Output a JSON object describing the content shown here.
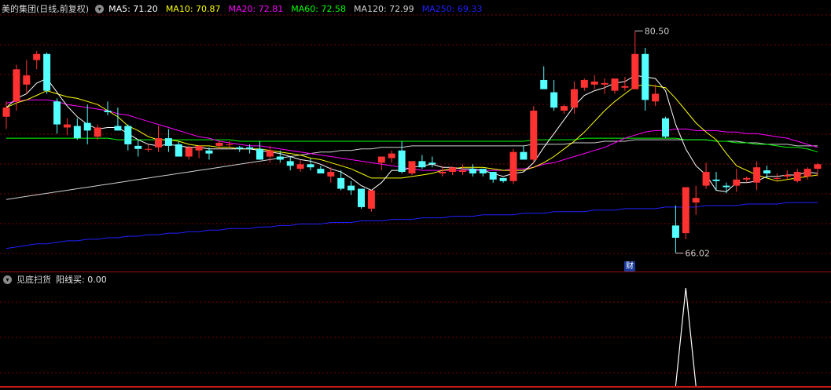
{
  "header": {
    "title": "美的集团(日线,前复权)",
    "collapse_icon": "chevron-down-icon",
    "ma": [
      {
        "label": "MA5: 71.20",
        "color": "#ffffff"
      },
      {
        "label": "MA10: 70.87",
        "color": "#ffff00"
      },
      {
        "label": "MA20: 72.81",
        "color": "#ff00ff"
      },
      {
        "label": "MA60: 72.58",
        "color": "#00ff00"
      },
      {
        "label": "MA120: 72.99",
        "color": "#d0d0d0"
      },
      {
        "label": "MA250: 69.33",
        "color": "#2020ff"
      }
    ]
  },
  "annotations": {
    "high_label": "80.50",
    "low_label": "66.02",
    "event_badge": "财"
  },
  "indicator": {
    "title": "见底扫货",
    "series_label": "阳线买: 0.00"
  },
  "colors": {
    "up": "#ff3232",
    "down": "#54ffff",
    "ma5": "#ffffff",
    "ma10": "#ffff00",
    "ma20": "#ff00ff",
    "ma60": "#00ff00",
    "ma120": "#d0d0d0",
    "ma250": "#2020ff",
    "grid": "#7a0000",
    "indicator_line": "#ffffff"
  },
  "chart_data": {
    "type": "candlestick",
    "y_range": [
      65.0,
      81.5
    ],
    "high_price": 80.5,
    "low_price": 66.02,
    "candles": [
      [
        74.9,
        75.9,
        74.1,
        75.5
      ],
      [
        75.9,
        78.3,
        75.3,
        78.0
      ],
      [
        77.0,
        78.6,
        76.4,
        77.6
      ],
      [
        78.6,
        79.2,
        78.0,
        79.0
      ],
      [
        79.0,
        79.1,
        76.4,
        76.6
      ],
      [
        75.9,
        76.1,
        73.8,
        74.4
      ],
      [
        74.2,
        74.8,
        73.7,
        74.4
      ],
      [
        74.3,
        74.8,
        73.4,
        73.5
      ],
      [
        74.5,
        75.7,
        73.1,
        74.0
      ],
      [
        73.6,
        74.4,
        73.4,
        74.2
      ],
      [
        75.3,
        75.9,
        75.0,
        75.2
      ],
      [
        74.3,
        75.5,
        74.0,
        74.0
      ],
      [
        74.3,
        74.4,
        72.7,
        73.1
      ],
      [
        73.0,
        73.4,
        72.3,
        72.8
      ],
      [
        72.8,
        73.1,
        72.6,
        72.8
      ],
      [
        72.9,
        74.3,
        72.6,
        73.5
      ],
      [
        73.5,
        74.1,
        72.6,
        73.0
      ],
      [
        73.1,
        73.3,
        72.3,
        72.3
      ],
      [
        72.3,
        73.0,
        72.1,
        72.9
      ],
      [
        72.7,
        73.0,
        72.2,
        73.0
      ],
      [
        72.7,
        72.9,
        72.1,
        72.5
      ],
      [
        73.0,
        73.3,
        72.8,
        73.2
      ],
      [
        73.1,
        73.3,
        72.9,
        73.1
      ],
      [
        72.9,
        73.0,
        72.6,
        72.8
      ],
      [
        72.9,
        73.1,
        72.5,
        72.8
      ],
      [
        72.8,
        73.3,
        72.1,
        72.1
      ],
      [
        72.3,
        73.0,
        71.9,
        72.7
      ],
      [
        72.3,
        72.7,
        71.9,
        72.1
      ],
      [
        72.0,
        72.3,
        71.4,
        71.7
      ],
      [
        71.5,
        72.1,
        71.3,
        71.8
      ],
      [
        71.8,
        72.2,
        71.4,
        71.6
      ],
      [
        71.5,
        71.7,
        71.2,
        71.2
      ],
      [
        71.0,
        71.6,
        70.6,
        71.3
      ],
      [
        70.9,
        71.4,
        70.1,
        70.2
      ],
      [
        70.4,
        70.7,
        69.8,
        70.1
      ],
      [
        70.2,
        70.2,
        68.9,
        69.0
      ],
      [
        68.9,
        70.1,
        68.7,
        70.1
      ],
      [
        71.9,
        72.3,
        71.4,
        72.3
      ],
      [
        72.2,
        72.7,
        71.9,
        72.5
      ],
      [
        72.7,
        73.3,
        71.2,
        71.3
      ],
      [
        71.2,
        72.0,
        71.1,
        72.0
      ],
      [
        72.0,
        72.4,
        71.5,
        71.6
      ],
      [
        71.9,
        72.3,
        71.6,
        71.8
      ],
      [
        71.2,
        71.7,
        71.0,
        71.3
      ],
      [
        71.3,
        71.6,
        71.1,
        71.6
      ],
      [
        71.3,
        71.8,
        71.1,
        71.4
      ],
      [
        71.5,
        71.8,
        71.0,
        71.2
      ],
      [
        71.5,
        71.4,
        71.0,
        71.2
      ],
      [
        71.3,
        71.3,
        70.6,
        70.8
      ],
      [
        70.9,
        70.9,
        70.6,
        70.7
      ],
      [
        70.7,
        72.8,
        70.5,
        72.6
      ],
      [
        72.6,
        73.0,
        72.1,
        72.1
      ],
      [
        72.1,
        75.6,
        71.9,
        75.3
      ],
      [
        77.3,
        78.2,
        76.8,
        76.7
      ],
      [
        76.5,
        77.3,
        75.3,
        75.5
      ],
      [
        75.3,
        75.7,
        75.1,
        75.6
      ],
      [
        75.5,
        77.2,
        75.1,
        76.7
      ],
      [
        76.8,
        77.4,
        76.6,
        77.3
      ],
      [
        77.0,
        77.6,
        76.7,
        77.2
      ],
      [
        77.0,
        77.4,
        76.4,
        77.1
      ],
      [
        76.6,
        77.2,
        76.4,
        77.4
      ],
      [
        76.8,
        77.5,
        76.6,
        76.9
      ],
      [
        76.7,
        80.5,
        76.7,
        79.0
      ],
      [
        79.0,
        79.4,
        75.3,
        76.0
      ],
      [
        75.9,
        77.0,
        75.6,
        76.4
      ],
      [
        74.8,
        74.9,
        73.5,
        73.6
      ],
      [
        67.8,
        69.1,
        66.0,
        67.0
      ],
      [
        67.3,
        70.2,
        66.9,
        70.3
      ],
      [
        69.3,
        70.4,
        68.5,
        69.6
      ],
      [
        70.4,
        71.9,
        70.2,
        71.3
      ],
      [
        70.8,
        71.3,
        70.1,
        70.7
      ],
      [
        70.4,
        70.6,
        69.9,
        70.3
      ],
      [
        70.4,
        71.5,
        70.0,
        70.8
      ],
      [
        70.8,
        71.0,
        70.6,
        70.9
      ],
      [
        70.6,
        72.0,
        70.1,
        71.6
      ],
      [
        71.4,
        71.7,
        70.9,
        71.2
      ],
      [
        70.9,
        71.2,
        70.7,
        70.9
      ],
      [
        71.0,
        71.4,
        70.8,
        71.1
      ],
      [
        70.7,
        71.5,
        70.6,
        71.3
      ],
      [
        71.0,
        71.6,
        70.8,
        71.5
      ],
      [
        71.5,
        71.9,
        71.0,
        71.8
      ]
    ],
    "ma5": [
      75.5,
      76.1,
      76.4,
      77.1,
      77.4,
      76.5,
      75.6,
      74.9,
      74.4,
      74.1,
      74.2,
      74.2,
      73.8,
      73.4,
      73.1,
      73.0,
      73.1,
      73.0,
      72.9,
      72.9,
      72.8,
      72.8,
      72.8,
      72.8,
      72.8,
      72.7,
      72.6,
      72.5,
      72.3,
      72.1,
      72.0,
      71.8,
      71.5,
      71.3,
      70.9,
      70.4,
      70.1,
      70.6,
      71.4,
      71.4,
      71.6,
      71.7,
      71.8,
      71.6,
      71.6,
      71.5,
      71.5,
      71.4,
      71.2,
      71.0,
      71.2,
      71.3,
      71.9,
      72.9,
      73.8,
      74.7,
      75.6,
      76.3,
      76.6,
      76.8,
      77.1,
      77.2,
      77.6,
      77.5,
      77.4,
      76.6,
      74.4,
      72.8,
      71.7,
      71.1,
      70.1,
      70.0,
      70.6,
      70.6,
      70.7,
      71.0,
      71.0,
      71.1,
      71.1,
      71.3,
      71.2
    ],
    "ma10": [
      75.5,
      75.8,
      76.0,
      76.3,
      76.6,
      76.4,
      76.2,
      76.1,
      75.9,
      75.7,
      75.3,
      74.9,
      74.3,
      74.0,
      73.6,
      73.4,
      73.4,
      73.3,
      73.1,
      73.0,
      73.0,
      72.9,
      72.9,
      72.8,
      72.8,
      72.8,
      72.7,
      72.6,
      72.5,
      72.4,
      72.2,
      72.1,
      71.9,
      71.7,
      71.5,
      71.2,
      70.9,
      70.9,
      70.9,
      70.9,
      71.0,
      71.1,
      71.2,
      71.4,
      71.5,
      71.6,
      71.6,
      71.6,
      71.5,
      71.4,
      71.4,
      71.4,
      71.6,
      71.9,
      72.3,
      72.8,
      73.3,
      73.9,
      74.6,
      75.3,
      75.9,
      76.4,
      76.9,
      77.0,
      76.9,
      76.8,
      76.1,
      75.3,
      74.5,
      73.9,
      73.4,
      72.5,
      71.7,
      71.4,
      71.1,
      70.9,
      70.7,
      70.8,
      70.9,
      71.0,
      71.1
    ],
    "ma20": [
      75.8,
      75.9,
      76.0,
      76.0,
      76.0,
      75.9,
      75.7,
      75.6,
      75.5,
      75.4,
      75.3,
      75.1,
      75.0,
      74.8,
      74.6,
      74.4,
      74.2,
      74.0,
      73.8,
      73.6,
      73.5,
      73.3,
      73.2,
      73.1,
      73.0,
      73.0,
      72.9,
      72.8,
      72.7,
      72.6,
      72.5,
      72.4,
      72.3,
      72.2,
      72.1,
      72.0,
      71.9,
      71.8,
      71.7,
      71.6,
      71.5,
      71.4,
      71.4,
      71.4,
      71.4,
      71.4,
      71.4,
      71.4,
      71.4,
      71.4,
      71.5,
      71.5,
      71.6,
      71.8,
      71.9,
      72.1,
      72.3,
      72.5,
      72.7,
      72.9,
      73.2,
      73.5,
      73.7,
      73.9,
      74.0,
      74.0,
      74.1,
      74.1,
      74.0,
      74.0,
      74.0,
      73.9,
      73.9,
      73.8,
      73.8,
      73.7,
      73.6,
      73.5,
      73.3,
      73.1,
      72.9
    ],
    "ma60": [
      73.5,
      73.5,
      73.5,
      73.5,
      73.5,
      73.5,
      73.5,
      73.5,
      73.5,
      73.5,
      73.5,
      73.4,
      73.4,
      73.4,
      73.4,
      73.4,
      73.4,
      73.4,
      73.4,
      73.4,
      73.4,
      73.4,
      73.4,
      73.3,
      73.3,
      73.3,
      73.3,
      73.3,
      73.3,
      73.3,
      73.3,
      73.3,
      73.3,
      73.3,
      73.3,
      73.3,
      73.3,
      73.3,
      73.3,
      73.3,
      73.3,
      73.3,
      73.3,
      73.3,
      73.3,
      73.3,
      73.3,
      73.3,
      73.3,
      73.3,
      73.3,
      73.3,
      73.4,
      73.4,
      73.4,
      73.4,
      73.4,
      73.5,
      73.5,
      73.5,
      73.5,
      73.5,
      73.5,
      73.5,
      73.5,
      73.5,
      73.5,
      73.4,
      73.4,
      73.4,
      73.3,
      73.3,
      73.2,
      73.2,
      73.1,
      73.1,
      73.0,
      72.9,
      72.9,
      72.8,
      72.6
    ],
    "ma120": [
      69.5,
      69.6,
      69.7,
      69.8,
      69.9,
      70.0,
      70.1,
      70.2,
      70.3,
      70.4,
      70.5,
      70.6,
      70.7,
      70.8,
      70.9,
      71.0,
      71.1,
      71.2,
      71.3,
      71.4,
      71.5,
      71.6,
      71.7,
      71.8,
      71.9,
      72.0,
      72.1,
      72.2,
      72.3,
      72.4,
      72.5,
      72.6,
      72.6,
      72.7,
      72.7,
      72.8,
      72.8,
      72.9,
      72.9,
      72.9,
      73.0,
      73.0,
      73.0,
      73.0,
      73.0,
      73.0,
      73.0,
      73.0,
      73.0,
      73.0,
      73.0,
      73.0,
      73.1,
      73.1,
      73.1,
      73.1,
      73.2,
      73.2,
      73.2,
      73.3,
      73.3,
      73.3,
      73.4,
      73.4,
      73.4,
      73.4,
      73.4,
      73.4,
      73.4,
      73.4,
      73.3,
      73.3,
      73.3,
      73.2,
      73.2,
      73.1,
      73.1,
      73.1,
      73.0,
      73.0,
      73.0
    ],
    "ma250": [
      66.3,
      66.4,
      66.5,
      66.6,
      66.6,
      66.7,
      66.8,
      66.8,
      66.9,
      66.9,
      67.0,
      67.0,
      67.1,
      67.1,
      67.2,
      67.2,
      67.3,
      67.3,
      67.4,
      67.4,
      67.5,
      67.5,
      67.6,
      67.6,
      67.6,
      67.7,
      67.7,
      67.8,
      67.8,
      67.9,
      67.9,
      67.9,
      68.0,
      68.0,
      68.0,
      68.1,
      68.1,
      68.1,
      68.2,
      68.2,
      68.2,
      68.3,
      68.3,
      68.3,
      68.4,
      68.4,
      68.4,
      68.5,
      68.5,
      68.5,
      68.5,
      68.6,
      68.6,
      68.6,
      68.7,
      68.7,
      68.7,
      68.7,
      68.8,
      68.8,
      68.8,
      68.9,
      68.9,
      68.9,
      68.9,
      69.0,
      69.0,
      69.0,
      69.0,
      69.1,
      69.1,
      69.1,
      69.1,
      69.2,
      69.2,
      69.2,
      69.2,
      69.3,
      69.3,
      69.3,
      69.3
    ],
    "indicator": [
      0,
      0,
      0,
      0,
      0,
      0,
      0,
      0,
      0,
      0,
      0,
      0,
      0,
      0,
      0,
      0,
      0,
      0,
      0,
      0,
      0,
      0,
      0,
      0,
      0,
      0,
      0,
      0,
      0,
      0,
      0,
      0,
      0,
      0,
      0,
      0,
      0,
      0,
      0,
      0,
      0,
      0,
      0,
      0,
      0,
      0,
      0,
      0,
      0,
      0,
      0,
      0,
      0,
      0,
      0,
      0,
      0,
      0,
      0,
      0,
      0,
      0,
      0,
      0,
      0,
      0,
      0,
      1,
      0,
      0,
      0,
      0,
      0,
      0,
      0,
      0,
      0,
      0,
      0,
      0,
      0
    ]
  }
}
